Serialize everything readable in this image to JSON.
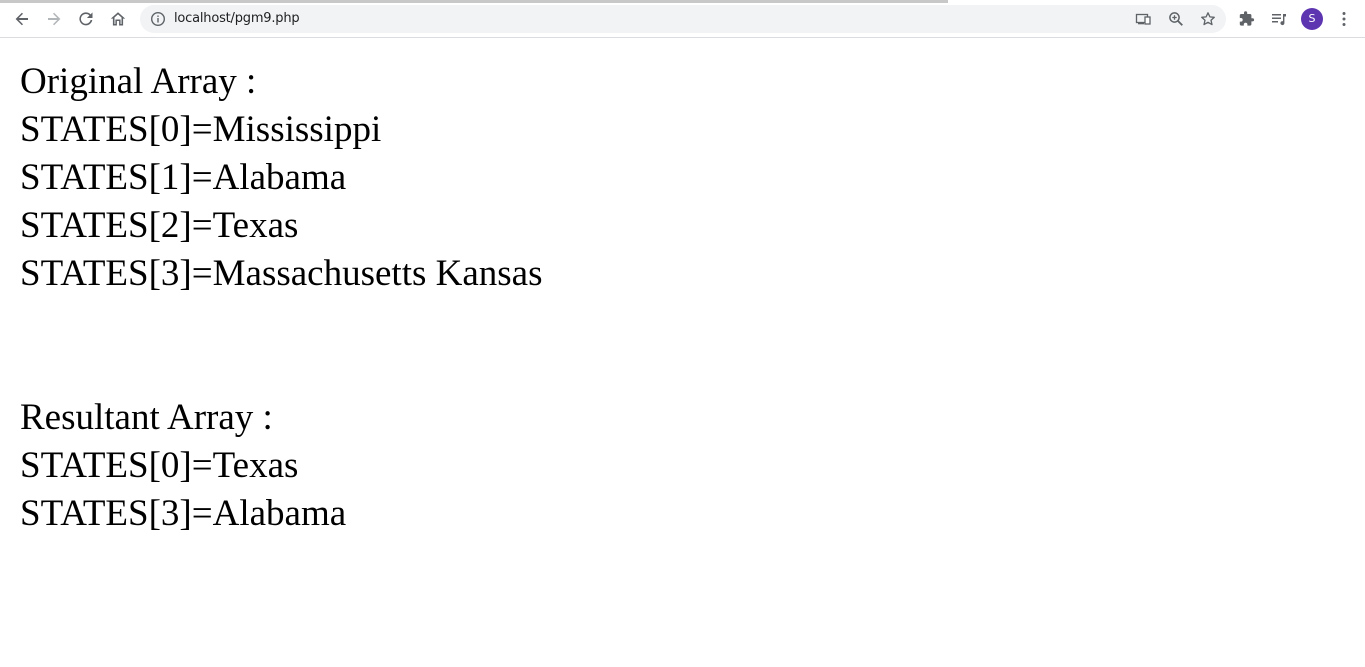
{
  "browser": {
    "url": "localhost/pgm9.php",
    "icons": {
      "back": "arrow-left-icon",
      "forward": "arrow-right-icon",
      "reload": "reload-icon",
      "home": "home-icon",
      "site_info": "info-icon",
      "cast": "cast-icon",
      "zoom": "zoom-icon",
      "bookmark": "star-icon",
      "extensions": "puzzle-icon",
      "media": "media-queue-icon",
      "menu": "kebab-menu-icon"
    },
    "profile_initial": "S",
    "profile_color": "#5e35b1"
  },
  "page": {
    "original_heading": "Original Array :",
    "original_items": [
      "STATES[0]=Mississippi",
      "STATES[1]=Alabama",
      "STATES[2]=Texas",
      "STATES[3]=Massachusetts Kansas"
    ],
    "resultant_heading": "Resultant Array :",
    "resultant_items": [
      "STATES[0]=Texas",
      "STATES[3]=Alabama"
    ]
  }
}
